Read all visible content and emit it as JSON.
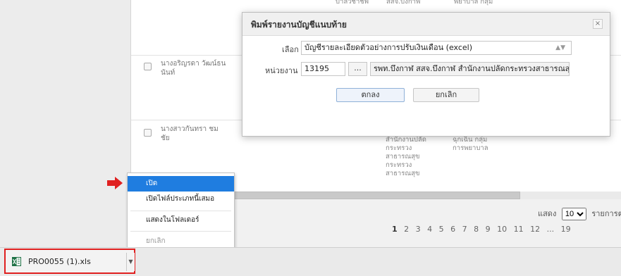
{
  "table": {
    "row1": {
      "name": "นางอริญรดา วัฒน์ธนนันท์"
    },
    "row2": {
      "name": "นางสาวกันทรา ชมชัย",
      "col_dept": "สำนักงานปลัด กระทรวงสาธารณสุข กระทรวงสาธารณสุข",
      "col_group": "ฉุกเฉิน กลุ่ม การพยาบาล"
    },
    "top_partial": {
      "col_a": "บาลวิชาชีพ",
      "col_b": "สสจ.บึงกาฬ",
      "col_c": "พยาบาล กลุ่ม"
    }
  },
  "modal": {
    "title": "พิมพ์รายงานบัญชีแนบท้าย",
    "close_glyph": "×",
    "select_label": "เลือก",
    "select_value": "บัญชีรายละเอียดตัวอย่างการปรับเงินเดือน (excel)",
    "unit_label": "หน่วยงาน",
    "unit_code": "13195",
    "browse_label": "...",
    "unit_name": "รพท.บึงกาฬ สสจ.บึงกาฬ สำนักงานปลัดกระทรวงสาธารณสุข",
    "ok_label": "ตกลง",
    "cancel_label": "ยกเลิก"
  },
  "pagination": {
    "pages": [
      "1",
      "2",
      "3",
      "4",
      "5",
      "6",
      "7",
      "8",
      "9",
      "10",
      "11",
      "12",
      "...",
      "19"
    ],
    "current": "1",
    "show_label": "แสดง",
    "show_value": "10",
    "per_label": "รายการต่อ"
  },
  "context_menu": {
    "items": [
      "เปิด",
      "เปิดไฟล์ประเภทนี้เสมอ",
      "แสดงในโฟลเดอร์",
      "ยกเลิก"
    ],
    "selected_index": 0
  },
  "download_bar": {
    "file_name": "PRO0055 (1).xls"
  },
  "colors": {
    "accent": "#1f7de0",
    "highlight_border": "#e02020"
  }
}
